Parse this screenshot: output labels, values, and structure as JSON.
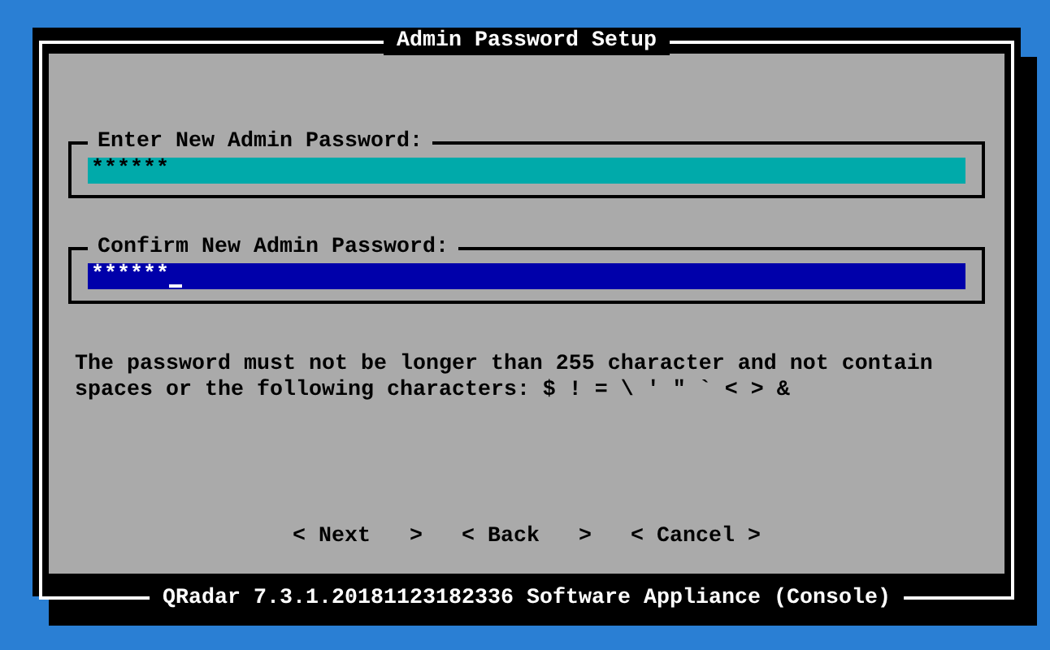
{
  "dialog": {
    "title": "Admin Password Setup",
    "fields": [
      {
        "label": "Enter New Admin Password:",
        "value": "******",
        "focused": false
      },
      {
        "label": "Confirm New Admin Password:",
        "value": "******",
        "focused": true
      }
    ],
    "message": "The password must not be longer than 255 character and not contain spaces or the following characters: $ ! = \\ ' \" ` < > &",
    "buttons": [
      "< Next   >",
      "< Back   >",
      "< Cancel >"
    ]
  },
  "footer": "QRadar 7.3.1.20181123182336 Software Appliance (Console)"
}
